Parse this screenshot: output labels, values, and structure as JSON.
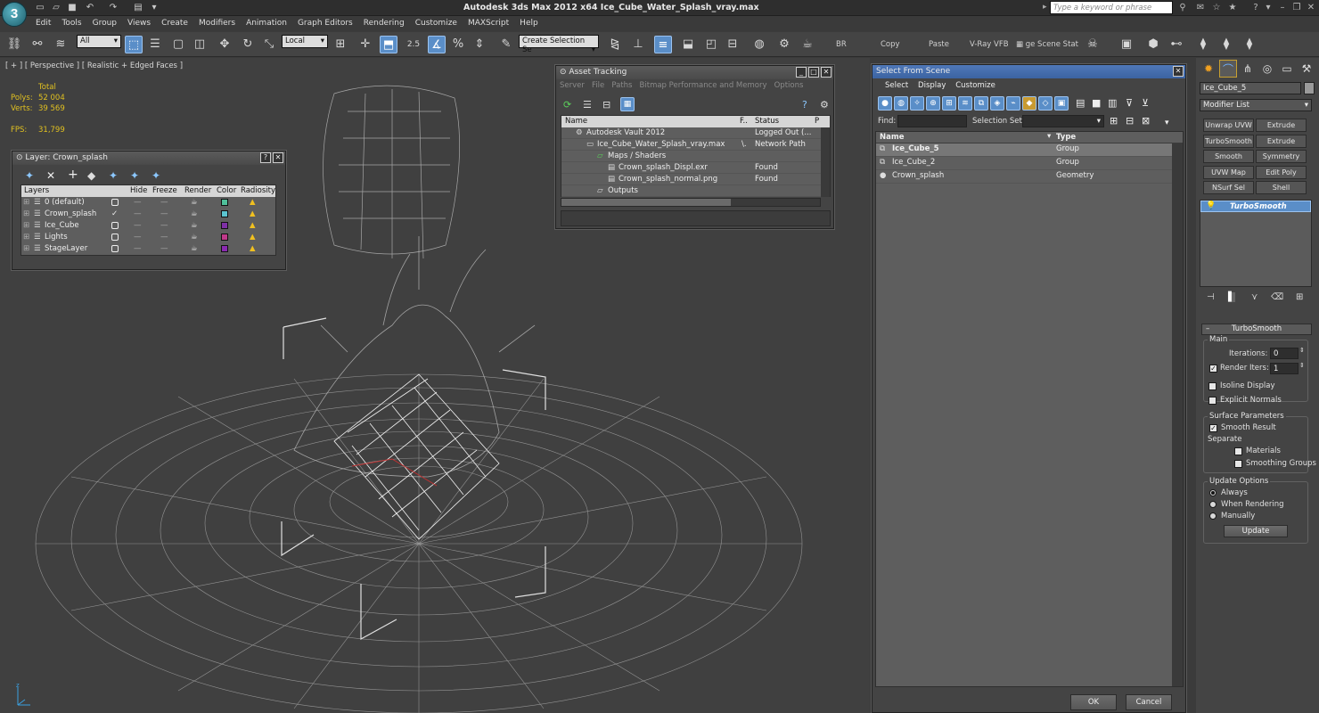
{
  "app": {
    "title": "Autodesk 3ds Max  2012 x64      Ice_Cube_Water_Splash_vray.max",
    "search_placeholder": "Type a keyword or phrase",
    "logo": "3"
  },
  "menu": [
    "Edit",
    "Tools",
    "Group",
    "Views",
    "Create",
    "Modifiers",
    "Animation",
    "Graph Editors",
    "Rendering",
    "Customize",
    "MAXScript",
    "Help"
  ],
  "toolbar": {
    "filter_value": "All",
    "coord_value": "Local",
    "snap_label": "2.5",
    "named_selection_placeholder": "Create Selection Se",
    "br_label": "BR",
    "copy_label": "Copy",
    "paste_label": "Paste",
    "vfb_label": "V-Ray VFB",
    "scene_states_label": "ge Scene Stat"
  },
  "viewport": {
    "label": "[ + ] [ Perspective ] [ Realistic + Edged Faces ]",
    "stats_header": "Total",
    "polys_label": "Polys:",
    "polys_value": "52 004",
    "verts_label": "Verts:",
    "verts_value": "39 569",
    "fps_label": "FPS:",
    "fps_value": "31,799"
  },
  "layer_window": {
    "title": "Layer: Crown_splash",
    "columns": [
      "Layers",
      "Hide",
      "Freeze",
      "Render",
      "Color",
      "Radiosity"
    ],
    "rows": [
      {
        "name": "0 (default)",
        "current": false,
        "color": "#4fbf9a"
      },
      {
        "name": "Crown_splash",
        "current": true,
        "color": "#5bc4d0"
      },
      {
        "name": "Ice_Cube",
        "current": false,
        "color": "#7e2fa6"
      },
      {
        "name": "Lights",
        "current": false,
        "color": "#c0398a"
      },
      {
        "name": "StageLayer",
        "current": false,
        "color": "#8a2ab0"
      }
    ]
  },
  "asset_tracking": {
    "title": "Asset Tracking",
    "menu": [
      "Server",
      "File",
      "Paths",
      "Bitmap Performance and Memory",
      "Options"
    ],
    "columns": [
      "Name",
      "F..",
      "Status",
      "P"
    ],
    "rows": [
      {
        "name": "Autodesk Vault 2012",
        "f": "",
        "status": "Logged Out (...",
        "indent": 1
      },
      {
        "name": "Ice_Cube_Water_Splash_vray.max",
        "f": "\\.",
        "status": "Network Path",
        "indent": 2
      },
      {
        "name": "Maps / Shaders",
        "f": "",
        "status": "",
        "indent": 3
      },
      {
        "name": "Crown_splash_Displ.exr",
        "f": "",
        "status": "Found",
        "indent": 4
      },
      {
        "name": "Crown_splash_normal.png",
        "f": "",
        "status": "Found",
        "indent": 4
      },
      {
        "name": "Outputs",
        "f": "",
        "status": "",
        "indent": 3
      }
    ]
  },
  "select_from_scene": {
    "title": "Select From Scene",
    "menu": [
      "Select",
      "Display",
      "Customize"
    ],
    "find_label": "Find:",
    "selection_set_label": "Selection Set:",
    "columns": [
      "Name",
      "Type"
    ],
    "rows": [
      {
        "name": "Ice_Cube_5",
        "type": "Group",
        "selected": true
      },
      {
        "name": "Ice_Cube_2",
        "type": "Group",
        "selected": false
      },
      {
        "name": "Crown_splash",
        "type": "Geometry",
        "selected": false
      }
    ],
    "ok_label": "OK",
    "cancel_label": "Cancel"
  },
  "command_panel": {
    "object_name": "Ice_Cube_5",
    "modifier_list_label": "Modifier List",
    "modifier_buttons": [
      "Unwrap UVW",
      "Extrude",
      "TurboSmooth",
      "Extrude",
      "Smooth",
      "Symmetry",
      "UVW Map",
      "Edit Poly",
      "NSurf Sel",
      "Shell"
    ],
    "stack_item": "TurboSmooth",
    "rollout_title": "TurboSmooth",
    "main_group": "Main",
    "iterations_label": "Iterations:",
    "iterations_value": "0",
    "render_iters_label": "Render Iters:",
    "render_iters_value": "1",
    "isoline_label": "Isoline Display",
    "explicit_normals_label": "Explicit Normals",
    "surface_group": "Surface Parameters",
    "smooth_result_label": "Smooth Result",
    "separate_label": "Separate",
    "materials_label": "Materials",
    "smoothing_groups_label": "Smoothing Groups",
    "update_group": "Update Options",
    "always_label": "Always",
    "when_rendering_label": "When Rendering",
    "manually_label": "Manually",
    "update_button": "Update"
  }
}
